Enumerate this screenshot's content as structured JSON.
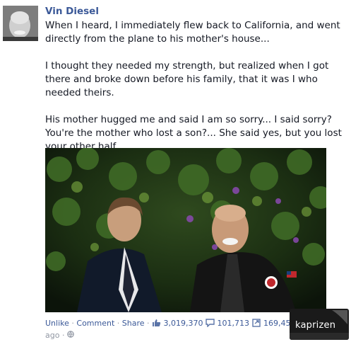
{
  "post": {
    "author": "Vin Diesel",
    "paragraphs": [
      "When I heard, I immediately flew back to California, and went directly from the plane to his mother's house...",
      "I thought they needed my strength, but realized when I got there and broke down before his family, that it was I who needed theirs.",
      "His mother hugged me and said I am so sorry... I said sorry? You're the mother who lost a son?... She said yes, but you lost your other half..."
    ]
  },
  "actions": {
    "unlike": "Unlike",
    "comment": "Comment",
    "share": "Share",
    "separator": "·",
    "likes": "3,019,370",
    "comments": "101,713",
    "shares": "169,45",
    "ago": "ago ·"
  },
  "watermark": "kaprizen",
  "colors": {
    "link": "#3b5998",
    "text": "#141823",
    "meta": "#9197a3"
  },
  "icons": [
    "thumbs-up-icon",
    "comment-bubble-icon",
    "share-icon",
    "globe-icon"
  ]
}
